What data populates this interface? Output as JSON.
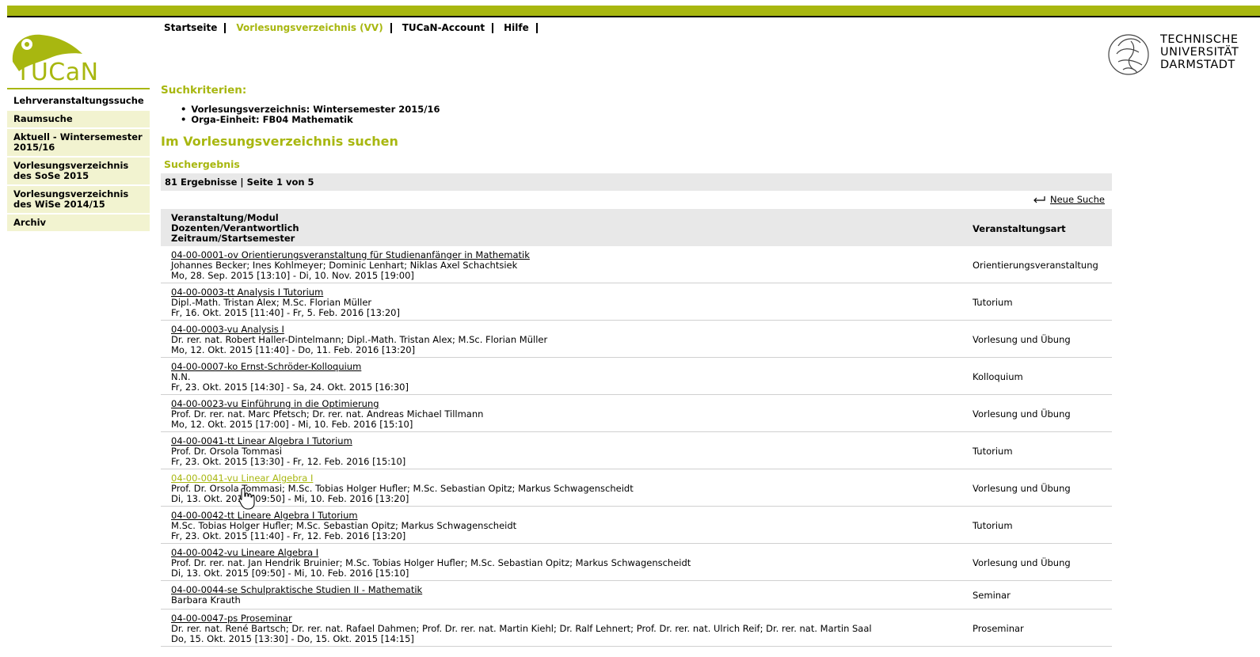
{
  "topnav": [
    {
      "label": "Startseite"
    },
    {
      "label": "Vorlesungsverzeichnis (VV)"
    },
    {
      "label": "TUCaN-Account"
    },
    {
      "label": "Hilfe"
    }
  ],
  "logo": {
    "text": "TUCaN"
  },
  "university": {
    "line1": "TECHNISCHE",
    "line2": "UNIVERSITÄT",
    "line3": "DARMSTADT"
  },
  "sidebar": [
    {
      "label": "Lehrveranstaltungssuche"
    },
    {
      "label": "Raumsuche"
    },
    {
      "label": "Aktuell - Wintersemester 2015/16"
    },
    {
      "label": "Vorlesungsverzeichnis des SoSe 2015"
    },
    {
      "label": "Vorlesungsverzeichnis des WiSe 2014/15"
    },
    {
      "label": "Archiv"
    }
  ],
  "criteria": {
    "heading": "Suchkriterien:",
    "items": [
      "Vorlesungsverzeichnis: Wintersemester 2015/16",
      "Orga-Einheit: FB04 Mathematik"
    ]
  },
  "search_heading": "Im Vorlesungsverzeichnis suchen",
  "result_heading": "Suchergebnis",
  "result_count": "81 Ergebnisse | Seite 1 von 5",
  "new_search": "Neue Suche",
  "table": {
    "header_col1": [
      "Veranstaltung/Modul",
      "Dozenten/Verantwortlich",
      "Zeitraum/Startsemester"
    ],
    "header_col2": "Veranstaltungsart",
    "rows": [
      {
        "title": "04-00-0001-ov Orientierungsveranstaltung für Studienanfänger in Mathematik",
        "lecturers": "Johannes Becker; Ines Kohlmeyer; Dominic Lenhart; Niklas Axel Schachtsiek",
        "period": "Mo, 28. Sep. 2015 [13:10] - Di, 10. Nov. 2015 [19:00]",
        "type": "Orientierungsveranstaltung"
      },
      {
        "title": "04-00-0003-tt Analysis I Tutorium",
        "lecturers": "Dipl.-Math. Tristan Alex; M.Sc. Florian Müller",
        "period": "Fr, 16. Okt. 2015 [11:40] - Fr, 5. Feb. 2016 [13:20]",
        "type": "Tutorium"
      },
      {
        "title": "04-00-0003-vu Analysis I",
        "lecturers": "Dr. rer. nat. Robert Haller-Dintelmann; Dipl.-Math. Tristan Alex; M.Sc. Florian Müller",
        "period": "Mo, 12. Okt. 2015 [11:40] - Do, 11. Feb. 2016 [13:20]",
        "type": "Vorlesung und Übung"
      },
      {
        "title": "04-00-0007-ko Ernst-Schröder-Kolloquium",
        "lecturers": "N.N.",
        "period": "Fr, 23. Okt. 2015 [14:30] - Sa, 24. Okt. 2015 [16:30]",
        "type": "Kolloquium"
      },
      {
        "title": "04-00-0023-vu Einführung in die Optimierung",
        "lecturers": "Prof. Dr. rer. nat. Marc Pfetsch; Dr. rer. nat. Andreas Michael Tillmann",
        "period": "Mo, 12. Okt. 2015 [17:00] - Mi, 10. Feb. 2016 [15:10]",
        "type": "Vorlesung und Übung"
      },
      {
        "title": "04-00-0041-tt Linear Algebra I Tutorium",
        "lecturers": "Prof. Dr. Orsola Tommasi",
        "period": "Fr, 23. Okt. 2015 [13:30] - Fr, 12. Feb. 2016 [15:10]",
        "type": "Tutorium"
      },
      {
        "title": "04-00-0041-vu Linear Algebra I",
        "lecturers": "Prof. Dr. Orsola Tommasi; M.Sc. Tobias Holger Hufler; M.Sc. Sebastian Opitz; Markus Schwagenscheidt",
        "period": "Di, 13. Okt. 2015 [09:50] - Mi, 10. Feb. 2016 [13:20]",
        "type": "Vorlesung und Übung"
      },
      {
        "title": "04-00-0042-tt Lineare Algebra I Tutorium",
        "lecturers": "M.Sc. Tobias Holger Hufler; M.Sc. Sebastian Opitz; Markus Schwagenscheidt",
        "period": "Fr, 23. Okt. 2015 [11:40] - Fr, 12. Feb. 2016 [13:20]",
        "type": "Tutorium"
      },
      {
        "title": "04-00-0042-vu Lineare Algebra I",
        "lecturers": "Prof. Dr. rer. nat. Jan Hendrik Bruinier; M.Sc. Tobias Holger Hufler; M.Sc. Sebastian Opitz; Markus Schwagenscheidt",
        "period": "Di, 13. Okt. 2015 [09:50] - Mi, 10. Feb. 2016 [15:10]",
        "type": "Vorlesung und Übung"
      },
      {
        "title": "04-00-0044-se Schulpraktische Studien II - Mathematik",
        "lecturers": "Barbara Krauth",
        "period": "",
        "type": "Seminar"
      },
      {
        "title": "04-00-0047-ps Proseminar",
        "lecturers": "Dr. rer. nat. René Bartsch; Dr. rer. nat. Rafael Dahmen; Prof. Dr. rer. nat. Martin Kiehl; Dr. Ralf Lehnert; Prof. Dr. rer. nat. Ulrich Reif; Dr. rer. nat. Martin Saal",
        "period": "Do, 15. Okt. 2015 [13:30] - Do, 15. Okt. 2015 [14:15]",
        "type": "Proseminar"
      }
    ]
  },
  "colors": {
    "accent": "#a8b710",
    "sidebar_bg": "#f2f3d0",
    "header_bg": "#e8e8e8"
  }
}
